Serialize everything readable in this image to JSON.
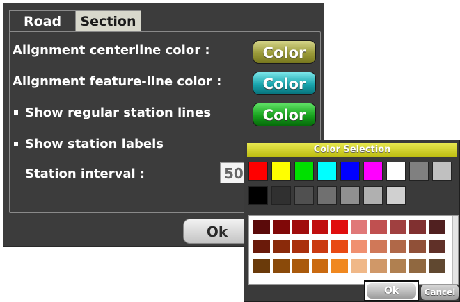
{
  "tabs": [
    {
      "label": "Road"
    },
    {
      "label": "Section"
    }
  ],
  "settings": {
    "centerline_label": "Alignment centerline color :",
    "featureline_label": "Alignment feature-line color :",
    "regular_lines_label": "Show regular station lines",
    "station_labels_label": "Show station labels",
    "interval_label": "Station interval :",
    "interval_value": "50",
    "color_button_label": "Color",
    "ok_label": "Ok"
  },
  "color_dialog": {
    "title": "Color Selection",
    "ok_label": "Ok",
    "cancel_label": "Cancel",
    "basic_colors_row1": [
      "#ff0000",
      "#ffff00",
      "#00e000",
      "#00ffff",
      "#0000ff",
      "#ff00ff",
      "#ffffff",
      "#808080",
      "#c0c0c0"
    ],
    "basic_colors_row2": [
      "#000000",
      "#303030",
      "#505050",
      "#707070",
      "#909090",
      "#b0b0b0",
      "#d0d0d0"
    ],
    "shade_rows": [
      [
        "#5a0a0a",
        "#800808",
        "#a00c0c",
        "#c00e0e",
        "#e00e0e",
        "#e07878",
        "#c05050",
        "#a04040",
        "#803030",
        "#502020"
      ],
      [
        "#6a1a0a",
        "#8a2a0a",
        "#aa300c",
        "#ca3a10",
        "#e84a14",
        "#f09070",
        "#d07858",
        "#b06848",
        "#905038",
        "#603028"
      ],
      [
        "#6a3a0a",
        "#8a4a0a",
        "#aa5a0c",
        "#ca6a10",
        "#f08820",
        "#f0b888",
        "#d09868",
        "#b08050",
        "#906840",
        "#604830"
      ]
    ]
  },
  "colors": {
    "panel_bg": "#3c3c3c",
    "centerline_color": "#9a9a3a",
    "featureline_color": "#1aa5ad",
    "stationline_color": "#18a21e",
    "dialog_title_color": "#d4d420"
  }
}
